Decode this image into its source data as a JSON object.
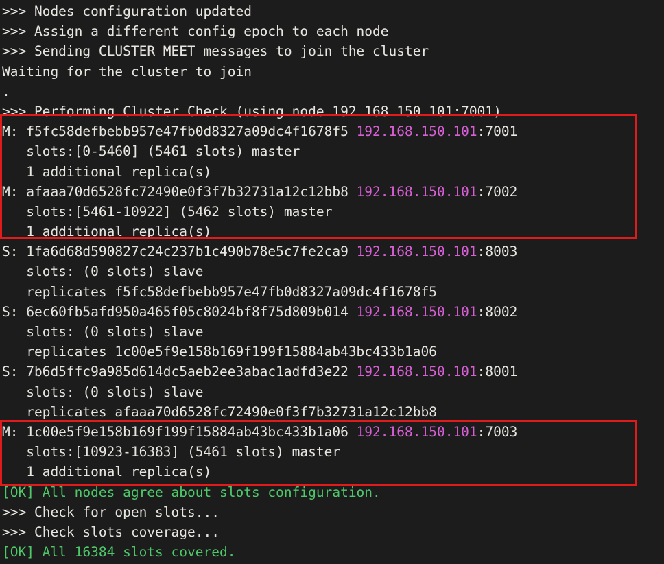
{
  "terminal": {
    "background_color": "#1c1c1c",
    "text_color": "#e8e6e0",
    "ip_color": "#d95fd6",
    "ok_color": "#4ec96a",
    "highlight_color": "#e01b1b",
    "ip_address": "192.168.150.101"
  },
  "lines": {
    "l01": ">>> Nodes configuration updated",
    "l02": ">>> Assign a different config epoch to each node",
    "l03": ">>> Sending CLUSTER MEET messages to join the cluster",
    "l04": "Waiting for the cluster to join",
    "l05": ".",
    "l06": ">>> Performing Cluster Check (using node 192.168.150.101:7001)",
    "m1_prefix": "M: f5fc58defbebb957e47fb0d8327a09dc4f1678f5 ",
    "m1_ip": "192.168.150.101",
    "m1_port": ":7001",
    "m1_slots": "   slots:[0-5460] (5461 slots) master",
    "m1_replicas": "   1 additional replica(s)",
    "m2_prefix": "M: afaaa70d6528fc72490e0f3f7b32731a12c12bb8 ",
    "m2_ip": "192.168.150.101",
    "m2_port": ":7002",
    "m2_slots": "   slots:[5461-10922] (5462 slots) master",
    "m2_replicas": "   1 additional replica(s)",
    "s1_prefix": "S: 1fa6d68d590827c24c237b1c490b78e5c7fe2ca9 ",
    "s1_ip": "192.168.150.101",
    "s1_port": ":8003",
    "s1_slots": "   slots: (0 slots) slave",
    "s1_replicates": "   replicates f5fc58defbebb957e47fb0d8327a09dc4f1678f5",
    "s2_prefix": "S: 6ec60fb5afd950a465f05c8024bf8f75d809b014 ",
    "s2_ip": "192.168.150.101",
    "s2_port": ":8002",
    "s2_slots": "   slots: (0 slots) slave",
    "s2_replicates": "   replicates 1c00e5f9e158b169f199f15884ab43bc433b1a06",
    "s3_prefix": "S: 7b6d5ffc9a985d614dc5aeb2ee3abac1adfd3e22 ",
    "s3_ip": "192.168.150.101",
    "s3_port": ":8001",
    "s3_slots": "   slots: (0 slots) slave",
    "s3_replicates": "   replicates afaaa70d6528fc72490e0f3f7b32731a12c12bb8",
    "m3_prefix": "M: 1c00e5f9e158b169f199f15884ab43bc433b1a06 ",
    "m3_ip": "192.168.150.101",
    "m3_port": ":7003",
    "m3_slots": "   slots:[10923-16383] (5461 slots) master",
    "m3_replicas": "   1 additional replica(s)",
    "ok1": "[OK] All nodes agree about slots configuration.",
    "l25": ">>> Check for open slots...",
    "l26": ">>> Check slots coverage...",
    "ok2": "[OK] All 16384 slots covered."
  }
}
